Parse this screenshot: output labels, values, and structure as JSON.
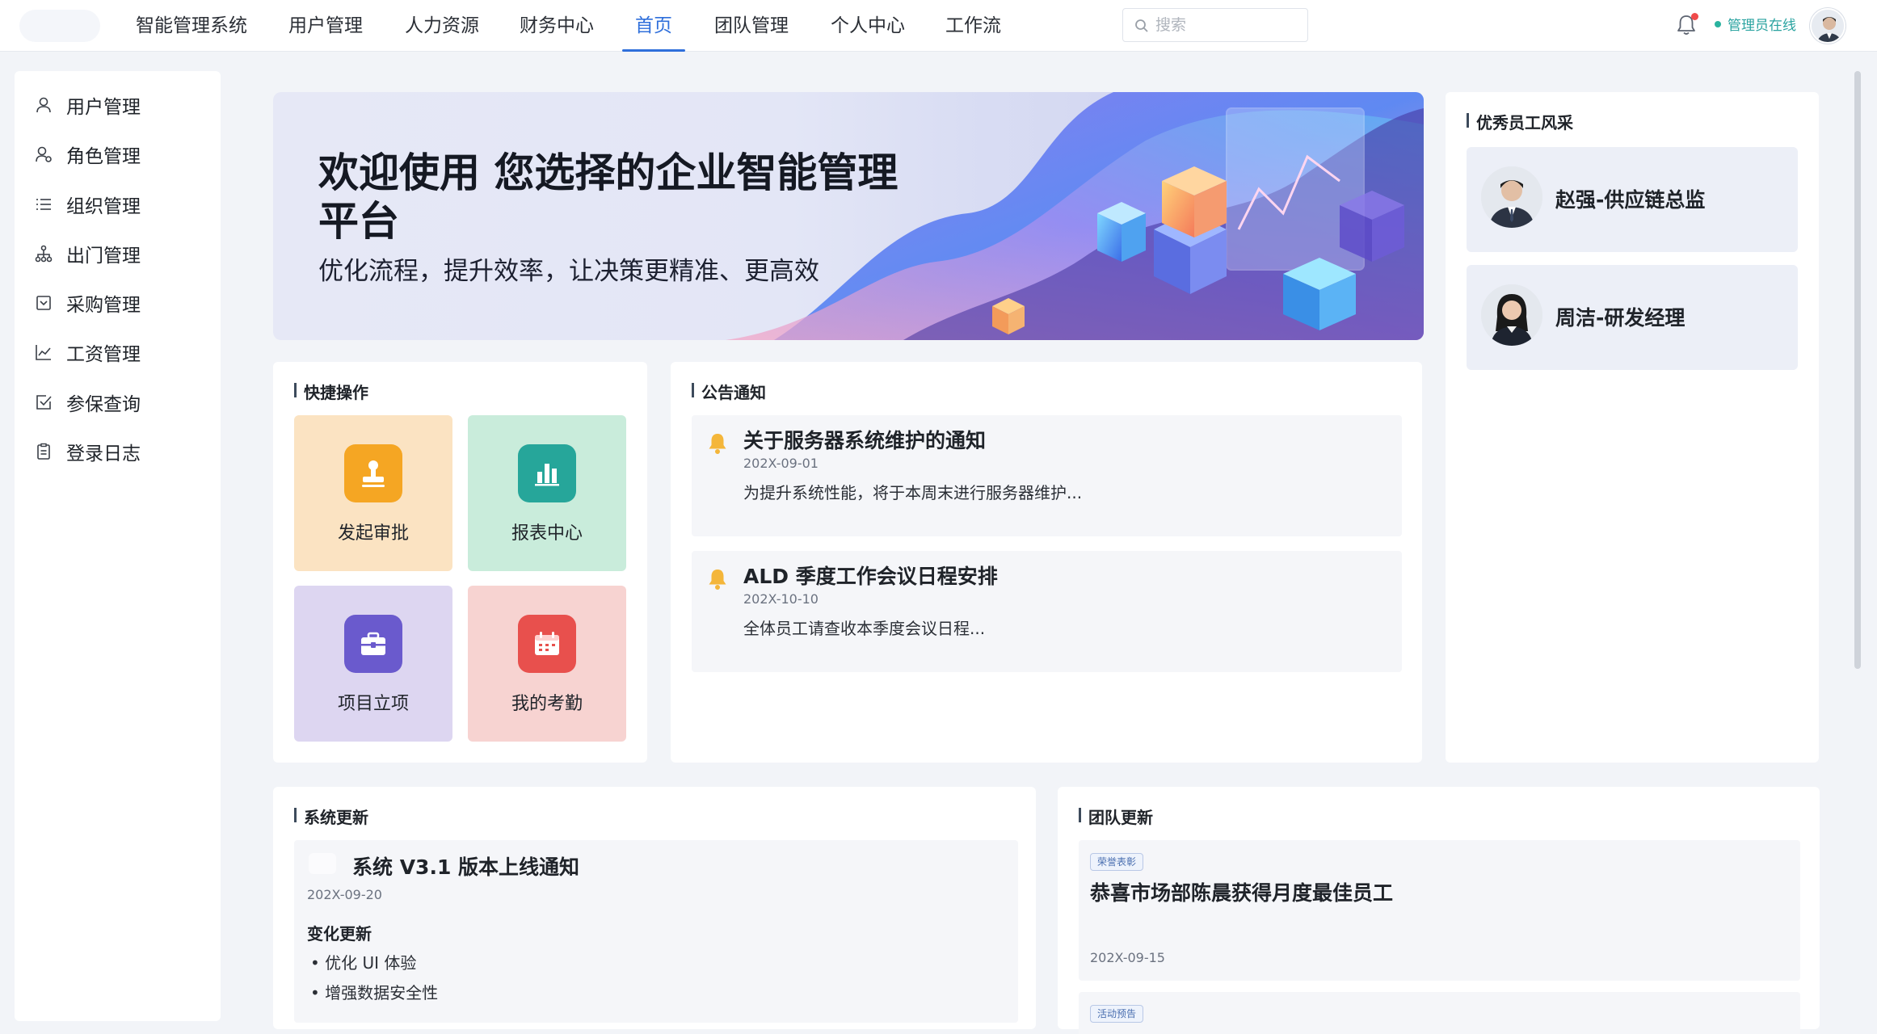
{
  "nav": {
    "items": [
      "智能管理系统",
      "用户管理",
      "人力资源",
      "财务中心",
      "首页",
      "团队管理",
      "个人中心",
      "工作流"
    ],
    "active": "首页"
  },
  "search": {
    "placeholder": "搜索"
  },
  "header": {
    "status": "管理员在线",
    "notification_dot_color": "#f04a4a"
  },
  "sidebar": {
    "items": [
      {
        "label": "用户管理",
        "icon": "user-icon"
      },
      {
        "label": "角色管理",
        "icon": "role-icon"
      },
      {
        "label": "组织管理",
        "icon": "list-icon"
      },
      {
        "label": "出门管理",
        "icon": "org-tree-icon"
      },
      {
        "label": "采购管理",
        "icon": "purchase-icon"
      },
      {
        "label": "工资管理",
        "icon": "chart-line-icon"
      },
      {
        "label": "参保查询",
        "icon": "checkbox-icon"
      },
      {
        "label": "登录日志",
        "icon": "clipboard-icon"
      }
    ]
  },
  "banner": {
    "title": "欢迎使用 您选择的企业智能管理平台",
    "subtitle": "优化流程，提升效率，让决策更精准、更高效"
  },
  "quick_ops": {
    "title": "快捷操作",
    "tiles": [
      {
        "label": "发起审批",
        "icon": "stamp-icon",
        "bg": "#fbe3c2",
        "icon_bg": "#f5a623"
      },
      {
        "label": "报表中心",
        "icon": "bar-chart-icon",
        "bg": "#c9ecdb",
        "icon_bg": "#26a69a"
      },
      {
        "label": "项目立项",
        "icon": "briefcase-icon",
        "bg": "#ddd6f1",
        "icon_bg": "#6a5acd"
      },
      {
        "label": "我的考勤",
        "icon": "calendar-icon",
        "bg": "#f7d3d1",
        "icon_bg": "#e8504d"
      }
    ]
  },
  "notices": {
    "title": "公告通知",
    "items": [
      {
        "title": "关于服务器系统维护的通知",
        "date": "202X-09-01",
        "body": "为提升系统性能，将于本周末进行服务器维护..."
      },
      {
        "title": "ALD 季度工作会议日程安排",
        "date": "202X-10-10",
        "body": "全体员工请查收本季度会议日程..."
      }
    ]
  },
  "employees": {
    "title": "优秀员工风采",
    "items": [
      {
        "name": "赵强-供应链总监"
      },
      {
        "name": "周洁-研发经理"
      }
    ]
  },
  "system_update": {
    "title": "系统更新",
    "item_title": "系统 V3.1 版本上线通知",
    "date": "202X-09-20",
    "change_heading": "变化更新",
    "changes": [
      "优化 UI 体验",
      "增强数据安全性"
    ]
  },
  "team_update": {
    "title": "团队更新",
    "items": [
      {
        "tag": "荣誉表彰",
        "title": "恭喜市场部陈晨获得月度最佳员工",
        "date": "202X-09-15"
      },
      {
        "tag": "活动预告"
      }
    ]
  }
}
